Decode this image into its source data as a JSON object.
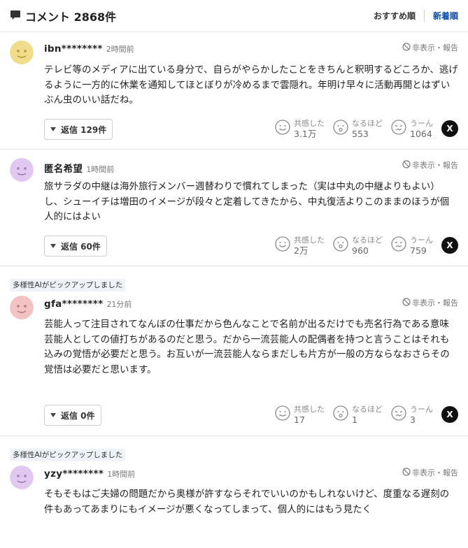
{
  "header": {
    "title": "コメント 2868件",
    "sort_recommended": "おすすめ順",
    "sort_newest": "新着順"
  },
  "labels": {
    "hide_report": "非表示・報告",
    "empathy": "共感した",
    "indeed": "なるほど",
    "hmm": "うーん",
    "x_glyph": "X"
  },
  "comments": [
    {
      "name": "ibn********",
      "time": "2時間前",
      "avatar_color": "#f0dc8a",
      "body": "テレビ等のメディアに出ている身分で、自らがやらかしたことをきちんと釈明するどころか、逃げるように一方的に休業を通知してほとぼりが冷めるまで雲隠れ。年明け早々に活動再開とはずいぶん虫のいい話だね。",
      "reply": "返信 129件",
      "empathy_count": "3.1万",
      "indeed_count": "553",
      "hmm_count": "1064"
    },
    {
      "name": "匿名希望",
      "time": "1時間前",
      "avatar_color": "#e0c8f0",
      "body": "旅サラダの中継は海外旅行メンバー週替わりで慣れてしまった（実は中丸の中継よりもよい）し、シューイチは増田のイメージが段々と定着してきたから、中丸復活よりこのままのほうが個人的にはよい",
      "reply": "返信 60件",
      "empathy_count": "2万",
      "indeed_count": "960",
      "hmm_count": "759"
    },
    {
      "pick": "多様性AIがピックアップしました",
      "name": "gfa********",
      "time": "21分前",
      "avatar_color": "#f3c2c2",
      "body": "芸能人って注目されてなんぼの仕事だから色んなことで名前が出るだけでも売名行為である意味芸能人としての値打ちがあるのだと思う。だから一流芸能人の配偶者を持つと言うことはそれも込みの覚悟が必要だと思う。お互いが一流芸能人ならまだしも片方が一般の方ならなおさらその覚悟は必要だと思います。",
      "reply": "返信 0件",
      "empathy_count": "17",
      "indeed_count": "1",
      "hmm_count": "3"
    },
    {
      "pick": "多様性AIがピックアップしました",
      "name": "yzy********",
      "time": "1時間前",
      "avatar_color": "#e0c8f0",
      "body": "そもそもはご夫婦の問題だから奥様が許すならそれでいいのかもしれないけど、度重なる遅刻の件もあってあまりにもイメージが悪くなってしまって、個人的にはもう見たく"
    }
  ]
}
